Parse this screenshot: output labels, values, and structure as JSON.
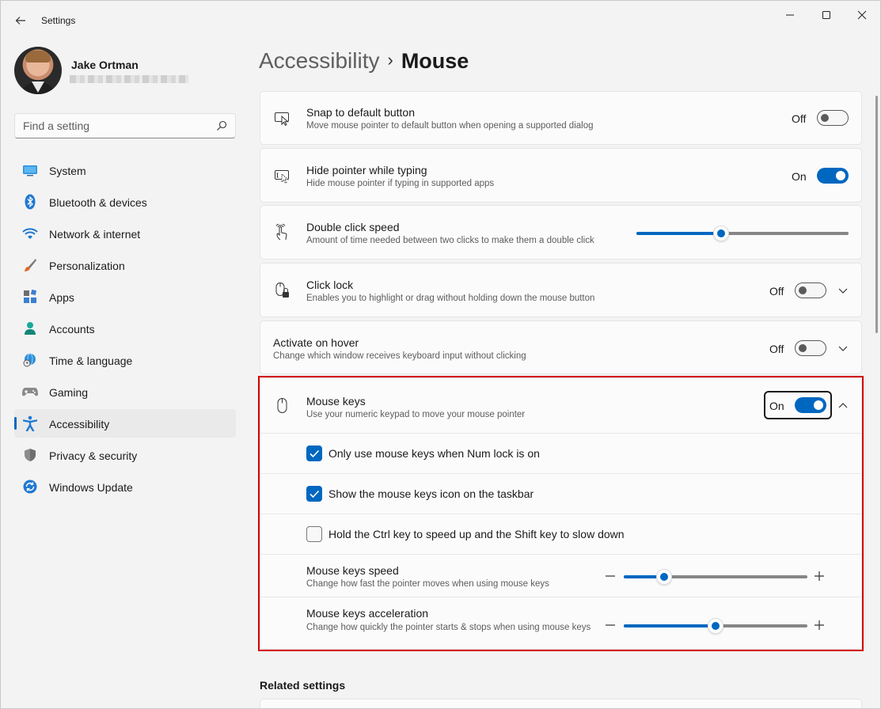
{
  "window": {
    "app_title": "Settings"
  },
  "profile": {
    "name": "Jake Ortman"
  },
  "search": {
    "placeholder": "Find a setting"
  },
  "nav": {
    "items": [
      {
        "label": "System",
        "icon": "system-icon"
      },
      {
        "label": "Bluetooth & devices",
        "icon": "bluetooth-icon"
      },
      {
        "label": "Network & internet",
        "icon": "wifi-icon"
      },
      {
        "label": "Personalization",
        "icon": "brush-icon"
      },
      {
        "label": "Apps",
        "icon": "apps-icon"
      },
      {
        "label": "Accounts",
        "icon": "person-icon"
      },
      {
        "label": "Time & language",
        "icon": "globe-clock-icon"
      },
      {
        "label": "Gaming",
        "icon": "gamepad-icon"
      },
      {
        "label": "Accessibility",
        "icon": "accessibility-icon",
        "active": true
      },
      {
        "label": "Privacy & security",
        "icon": "shield-icon"
      },
      {
        "label": "Windows Update",
        "icon": "update-icon"
      }
    ]
  },
  "breadcrumb": {
    "parent": "Accessibility",
    "separator": "›",
    "current": "Mouse"
  },
  "settings": {
    "snap": {
      "title": "Snap to default button",
      "desc": "Move mouse pointer to default button when opening a supported dialog",
      "state": "Off"
    },
    "hide_pointer": {
      "title": "Hide pointer while typing",
      "desc": "Hide mouse pointer if typing in supported apps",
      "state": "On"
    },
    "double_click": {
      "title": "Double click speed",
      "desc": "Amount of time needed between two clicks to make them a double click",
      "value_fraction": 0.4
    },
    "click_lock": {
      "title": "Click lock",
      "desc": "Enables you to highlight or drag without holding down the mouse button",
      "state": "Off"
    },
    "hover": {
      "title": "Activate on hover",
      "desc": "Change which window receives keyboard input without clicking",
      "state": "Off"
    },
    "mouse_keys": {
      "title": "Mouse keys",
      "desc": "Use your numeric keypad to move your mouse pointer",
      "state": "On",
      "options": [
        {
          "label": "Only use mouse keys when Num lock is on",
          "checked": true
        },
        {
          "label": "Show the mouse keys icon on the taskbar",
          "checked": true
        },
        {
          "label": "Hold the Ctrl key to speed up and the Shift key to slow down",
          "checked": false
        }
      ],
      "speed": {
        "title": "Mouse keys speed",
        "desc": "Change how fast the pointer moves when using mouse keys",
        "value_fraction": 0.22
      },
      "acceleration": {
        "title": "Mouse keys acceleration",
        "desc": "Change how quickly the pointer starts & stops when using mouse keys",
        "value_fraction": 0.5
      }
    }
  },
  "related": {
    "heading": "Related settings"
  },
  "colors": {
    "accent": "#0067c0",
    "highlight": "#d40000"
  }
}
